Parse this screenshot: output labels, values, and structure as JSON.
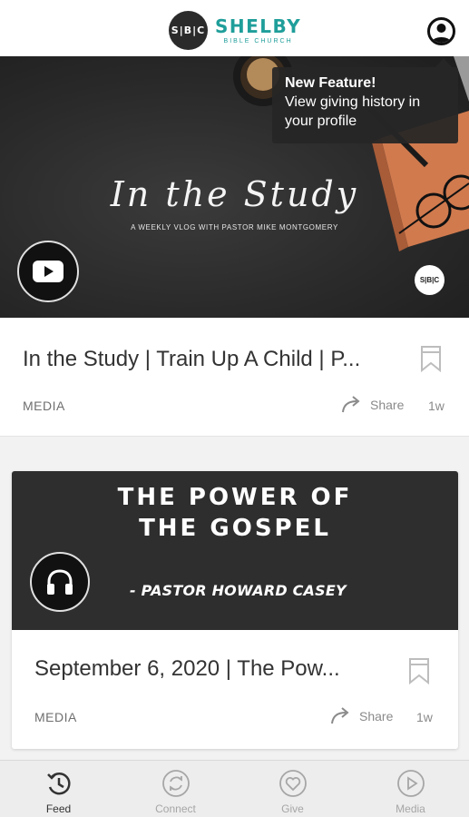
{
  "header": {
    "logo_badge": "S|B|C",
    "logo_name": "SHELBY",
    "logo_sub": "BIBLE CHURCH"
  },
  "tooltip": {
    "title": "New Feature!",
    "body": "View giving history in your profile"
  },
  "hero": {
    "title": "In the Study",
    "subtitle": "A WEEKLY VLOG WITH PASTOR MIKE MONTGOMERY",
    "badge": "S|B|C"
  },
  "cards": [
    {
      "title": "In the Study | Train Up A Child | P...",
      "category": "MEDIA",
      "share_label": "Share",
      "age": "1w"
    },
    {
      "image_title": "THE POWER OF THE GOSPEL",
      "image_title_line1": "THE POWER OF",
      "image_title_line2": "THE GOSPEL",
      "image_pastor": "- PASTOR HOWARD CASEY",
      "title": "September 6, 2020 | The Pow...",
      "category": "MEDIA",
      "share_label": "Share",
      "age": "1w"
    }
  ],
  "tabs": [
    {
      "label": "Feed",
      "icon": "feed-refresh-icon",
      "active": true
    },
    {
      "label": "Connect",
      "icon": "connect-arrows-icon",
      "active": false
    },
    {
      "label": "Give",
      "icon": "give-heart-icon",
      "active": false
    },
    {
      "label": "Media",
      "icon": "media-play-icon",
      "active": false
    }
  ],
  "colors": {
    "brand_teal": "#1f9e9a",
    "tab_active": "#333333",
    "tab_inactive": "#a6a6a6"
  }
}
